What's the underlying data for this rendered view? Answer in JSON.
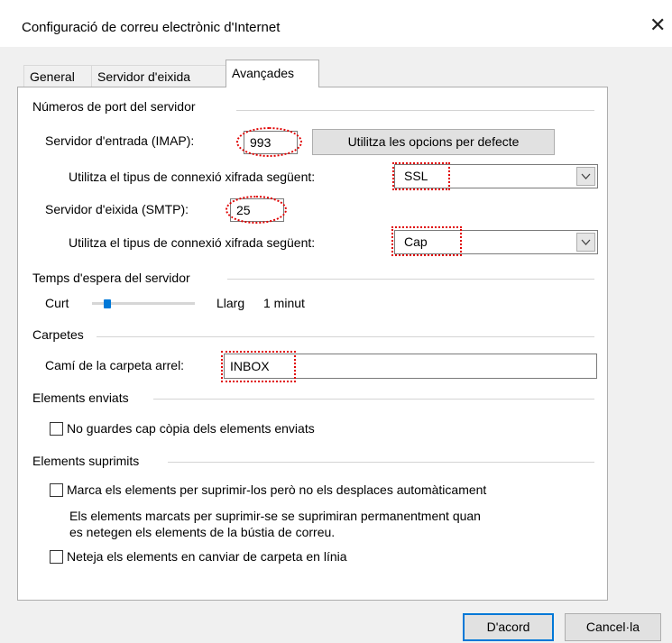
{
  "window": {
    "title": "Configuració de correu electrònic d'Internet",
    "close_glyph": "✕"
  },
  "tabs": [
    {
      "label": "General"
    },
    {
      "label": "Servidor d'eixida"
    },
    {
      "label": "Avançades"
    }
  ],
  "active_tab": "Avançades",
  "ports": {
    "group_title": "Números de port del servidor",
    "incoming_label": "Servidor d'entrada (IMAP):",
    "incoming_value": "993",
    "defaults_button": "Utilitza les opcions per defecte",
    "enc_label_1": "Utilitza el tipus de connexió xifrada següent:",
    "enc_value_1": "SSL",
    "outgoing_label": "Servidor d'eixida (SMTP):",
    "outgoing_value": "25",
    "enc_label_2": "Utilitza el tipus de connexió xifrada següent:",
    "enc_value_2": "Cap"
  },
  "timeout": {
    "group_title": "Temps d'espera del servidor",
    "short_label": "Curt",
    "long_label": "Llarg",
    "value": "1 minut",
    "slider_fraction": 0.12
  },
  "folders": {
    "group_title": "Carpetes",
    "root_label": "Camí de la carpeta arrel:",
    "root_value": "INBOX"
  },
  "sent": {
    "group_title": "Elements enviats",
    "no_copy_label": "No guardes cap còpia dels elements enviats",
    "no_copy_checked": false
  },
  "deleted": {
    "group_title": "Elements suprimits",
    "mark_label": "Marca els elements per suprimir-los però no els desplaces automàticament",
    "mark_checked": false,
    "note_line1": "Els elements marcats per suprimir-se se suprimiran permanentment quan",
    "note_line2": "es netegen els elements de la bústia de correu.",
    "purge_label": "Neteja els elements en canviar de carpeta en línia",
    "purge_checked": false
  },
  "buttons": {
    "ok": "D'acord",
    "cancel": "Cancel·la"
  },
  "colors": {
    "annotation": "#e00000",
    "accent": "#0078d7"
  }
}
